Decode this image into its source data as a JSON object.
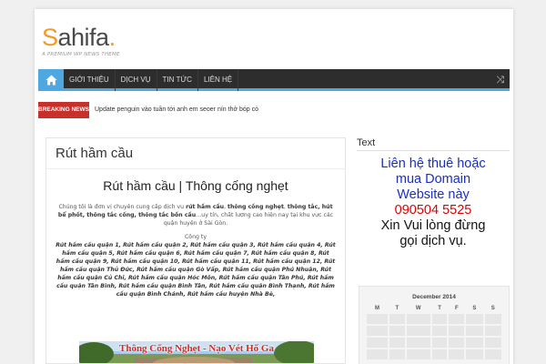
{
  "logo": {
    "s": "S",
    "rest": "ahifa",
    "dot": ".",
    "tagline": "A PREMIUM WP NEWS THEME"
  },
  "nav": {
    "items": [
      "GIỚI THIỆU",
      "DỊCH VỤ",
      "TIN TỨC",
      "LIÊN HỆ"
    ],
    "icons": [
      "home-icon",
      "shuffle-icon"
    ]
  },
  "breaking": {
    "label": "BREAKING NEWS",
    "text": "Update penguin vào tuần tới anh em seoer nín thở bóp cò",
    "color": "#c8302c"
  },
  "post": {
    "title": "Rút hầm cầu",
    "heading": "Rút hầm cầu | Thông cống nghẹt",
    "intro": {
      "p1": "Chúng tôi là đơn vị chuyên cung cấp dịch vụ ",
      "l1": "rút hầm cầu",
      "p2": ", ",
      "l2": "thông cống nghẹt",
      "p3": ", ",
      "b1": "thông tắc, hút bể phốt, thông tắc cống, thông tắc bồn cầu",
      "p4": "…uy tín, chất lượng cao hiện nay tại khu vực các quận huyện ở Sài Gòn."
    },
    "company": "Công ty",
    "links": "Rút hầm cầu quận 1, Rút hầm cầu quận 2, Rút hầm cầu quận 3, Rút hầm cầu quận 4, Rút hầm cầu quận 5, Rút hầm cầu quận 6, Rút hầm cầu quận 7, Rút hầm cầu quận 8, Rút hầm cầu quận 9, Rút hầm cầu quận 10, Rút hầm cầu quận 11, Rút hầm cầu quận 12, Rút hầm cầu quận Thủ Đức, Rút hầm cầu quận Gò Vấp, Rút hầm cầu quận Phú Nhuận, Rút hầm cầu quận Củ Chi, Rút hầm cầu quận Hóc Môn, Rút hầm cầu quận Tân Phú, Rút hầm cầu quận Tân Bình, Rút hầm cầu quận Bình Tân, Rút hầm cầu quận Bình Thạnh, Rút hầm cầu quận Bình Chánh, Rút hầm cầu huyện Nhà Bè,",
    "banner_text": "Thông Cống Nghẹt - Nạo Vét Hố Ga"
  },
  "sidebar": {
    "widget_title": "Text",
    "line1": "Liên hệ thuê hoặc",
    "line2": "mua Domain",
    "line3": "Website này",
    "phone": "090504 5525",
    "line4": "Xin Vui lòng đừng",
    "line5": "gọi dịch vụ."
  },
  "calendar": {
    "caption": "December 2014",
    "days": [
      "M",
      "T",
      "W",
      "T",
      "F",
      "S",
      "S"
    ]
  },
  "colors": {
    "accent": "#4fa8e0",
    "logo_orange": "#f39a26",
    "nav_bg": "#2d2d2d",
    "text_blue": "#1a2fbf",
    "text_red": "#dd0000"
  }
}
